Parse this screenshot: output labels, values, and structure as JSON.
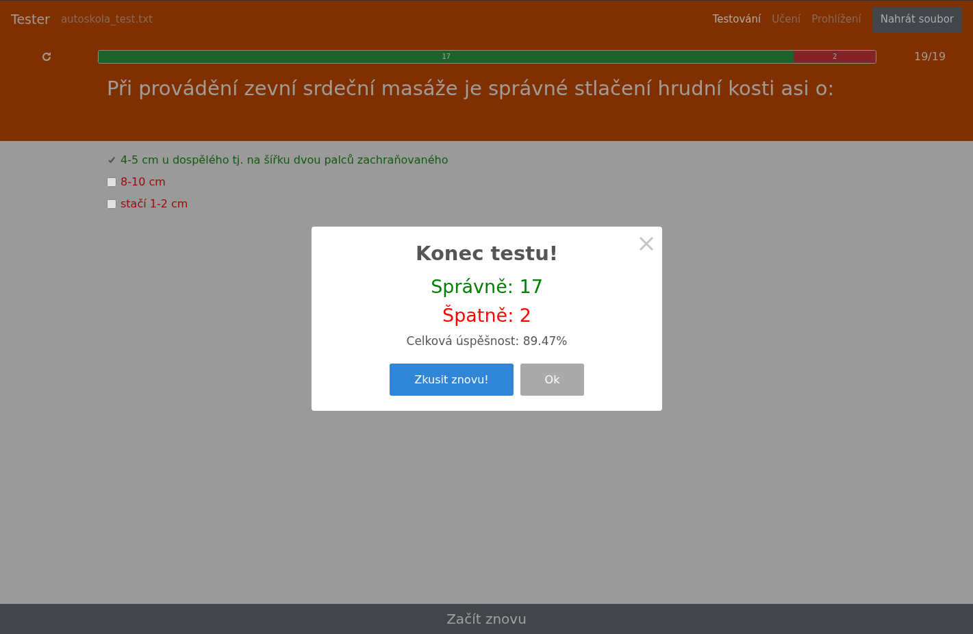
{
  "app_title": "Tester",
  "file_name": "autoskola_test.txt",
  "tabs": [
    {
      "label": "Testování",
      "selected": true
    },
    {
      "label": "Učení",
      "selected": false
    },
    {
      "label": "Prohlížení",
      "selected": false
    }
  ],
  "upload_button": "Nahrát soubor",
  "progress": {
    "segments": [
      {
        "kind": "correct",
        "label": "17",
        "level": 0.8947
      },
      {
        "kind": "wrong",
        "label": "2",
        "level": 0.1053
      }
    ],
    "counter": "19/19"
  },
  "question": "Při provádění zevní srdeční masáže je správné stlačení hrudní kosti asi o:",
  "answers": [
    {
      "text": "4-5 cm u dospělého tj. na šířku dvou palců zachraňovaného",
      "checked": true,
      "correct": true
    },
    {
      "text": "8-10 cm",
      "checked": false,
      "correct": false
    },
    {
      "text": "stačí 1-2 cm",
      "checked": false,
      "correct": false
    }
  ],
  "dialog": {
    "title": "Konec testu!",
    "correct_line": "Správně: 17",
    "wrong_line": "Špatně: 2",
    "summary": "Celková úspěšnost: 89.47%",
    "buttons": [
      {
        "kind": "primary",
        "label": "Zkusit znovu!"
      },
      {
        "kind": "secondary",
        "label": "Ok"
      }
    ]
  },
  "footer_button": "Začít znovu"
}
